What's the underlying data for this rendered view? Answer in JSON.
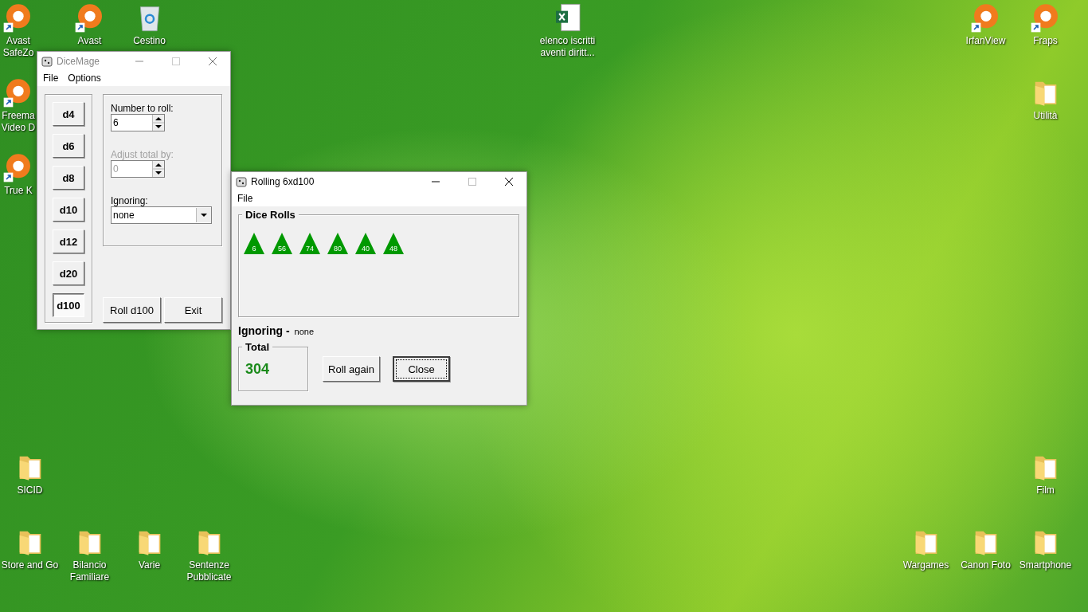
{
  "desktop_icons": [
    {
      "label": "Avast SafeZo",
      "kind": "app",
      "shortcut": true
    },
    {
      "label": "Avast",
      "kind": "app",
      "shortcut": true
    },
    {
      "label": "Cestino",
      "kind": "bin",
      "shortcut": false
    },
    {
      "label": "Freema Video D",
      "kind": "app",
      "shortcut": true
    },
    {
      "label": "True K",
      "kind": "app",
      "shortcut": true
    },
    {
      "label": "SICID",
      "kind": "folder",
      "shortcut": false
    },
    {
      "label": "Store and Go",
      "kind": "folder",
      "shortcut": false
    },
    {
      "label": "Bilancio Familiare",
      "kind": "folder",
      "shortcut": false
    },
    {
      "label": "Varie",
      "kind": "folder",
      "shortcut": false
    },
    {
      "label": "Sentenze Pubblicate",
      "kind": "folder",
      "shortcut": false
    },
    {
      "label": "elenco iscritti aventi diritt...",
      "kind": "sheet",
      "shortcut": false
    },
    {
      "label": "IrfanView",
      "kind": "app",
      "shortcut": true
    },
    {
      "label": "Fraps",
      "kind": "app",
      "shortcut": true
    },
    {
      "label": "Utilità",
      "kind": "folder",
      "shortcut": false
    },
    {
      "label": "Film",
      "kind": "folder",
      "shortcut": false
    },
    {
      "label": "Wargames",
      "kind": "folder",
      "shortcut": false
    },
    {
      "label": "Canon Foto",
      "kind": "folder",
      "shortcut": false
    },
    {
      "label": "Smartphone",
      "kind": "folder",
      "shortcut": false
    }
  ],
  "dicemage": {
    "title": "DiceMage",
    "menu": [
      "File",
      "Options"
    ],
    "dice_buttons": [
      {
        "label": "d4",
        "selected": false
      },
      {
        "label": "d6",
        "selected": false
      },
      {
        "label": "d8",
        "selected": false
      },
      {
        "label": "d10",
        "selected": false
      },
      {
        "label": "d12",
        "selected": false
      },
      {
        "label": "d20",
        "selected": false
      },
      {
        "label": "d100",
        "selected": true
      }
    ],
    "number_to_roll": {
      "label": "Number to roll:",
      "value": "6",
      "disabled": false
    },
    "adjust_total": {
      "label": "Adjust total by:",
      "value": "0",
      "disabled": true
    },
    "ignoring": {
      "label": "Ignoring:",
      "value": "none"
    },
    "buttons": [
      "Roll d100",
      "Exit"
    ]
  },
  "rolling": {
    "title": "Rolling 6xd100",
    "menu": [
      "File"
    ],
    "dice_rolls": {
      "title": "Dice Rolls",
      "values": [
        "6",
        "56",
        "74",
        "80",
        "40",
        "48"
      ]
    },
    "ignoring": {
      "label": "Ignoring -",
      "value": "none"
    },
    "total": {
      "title": "Total",
      "value": "304"
    },
    "buttons": [
      {
        "label": "Roll again",
        "focused": false
      },
      {
        "label": "Close",
        "focused": true
      }
    ]
  }
}
